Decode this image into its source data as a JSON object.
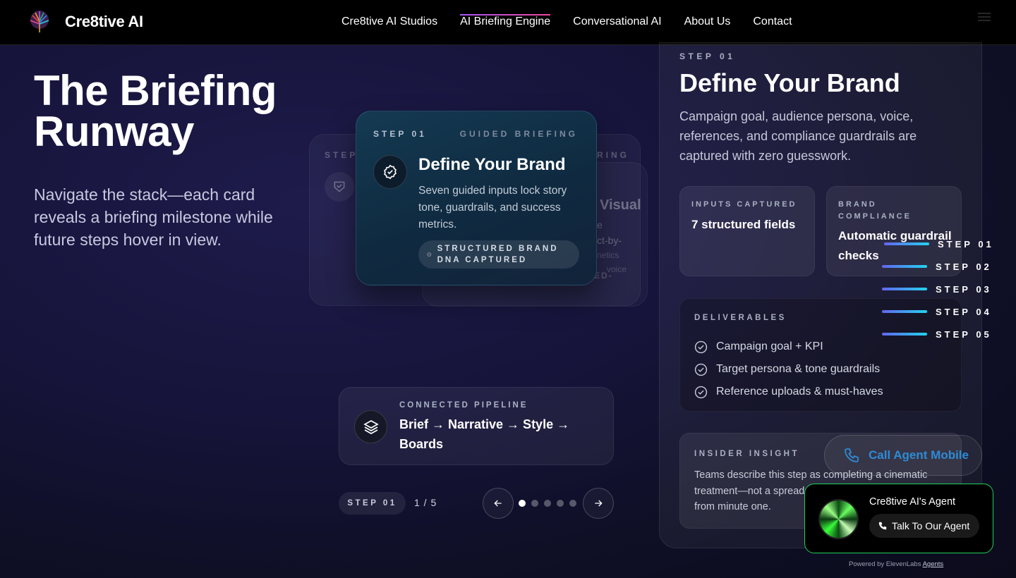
{
  "nav": {
    "brand": "Cre8tive AI",
    "links": [
      "Cre8tive AI Studios",
      "AI Briefing Engine",
      "Conversational AI",
      "About Us",
      "Contact"
    ]
  },
  "hero": {
    "title": "The Briefing Runway",
    "subtitle": "Navigate the stack—each card reveals a briefing milestone while future steps hover in view."
  },
  "card": {
    "step": "STEP 01",
    "tag": "GUIDED BRIEFING",
    "title": "Define Your Brand",
    "body": "Seven guided inputs lock story tone, guardrails, and success metrics.",
    "pill": "STRUCTURED BRAND DNA CAPTURED",
    "icon": "check-badge-icon"
  },
  "ghosts": {
    "back_step": "STEP 0",
    "back_tag": "RING",
    "mid_title": "Visual",
    "mid_lines": [
      "e",
      "ct-by-",
      "netics",
      "voice",
      "ED-"
    ]
  },
  "pipeline": {
    "kicker": "CONNECTED PIPELINE",
    "value": "Brief → Narrative → Style → Boards",
    "icon": "layers-icon"
  },
  "controls": {
    "step_badge": "STEP 01",
    "counter": "1 / 5",
    "dots": 5,
    "active_dot": 0
  },
  "panel": {
    "kicker": "STEP 01",
    "title": "Define Your Brand",
    "description": "Campaign goal, audience persona, voice, references, and compliance guardrails are captured with zero guesswork.",
    "inputs_label": "INPUTS CAPTURED",
    "inputs_value": "7 structured fields",
    "compliance_label": "BRAND COMPLIANCE",
    "compliance_value": "Automatic guardrail checks",
    "deliverables_label": "DELIVERABLES",
    "deliverables": [
      "Campaign goal + KPI",
      "Target persona & tone guardrails",
      "Reference uploads & must-haves"
    ],
    "insight_label": "INSIDER INSIGHT",
    "insight_text": "Teams describe this step as completing a cinematic treatment—not a spreadsheet. Everyone stays engaged from minute one."
  },
  "rail": [
    "STEP 01",
    "STEP 02",
    "STEP 03",
    "STEP 04",
    "STEP 05"
  ],
  "widget": {
    "call_label": "Call Agent Mobile",
    "agent_name": "Cre8tive AI's Agent",
    "talk_label": "Talk To Our Agent",
    "powered": "Powered by ElevenLabs",
    "powered_link": "Agents"
  }
}
